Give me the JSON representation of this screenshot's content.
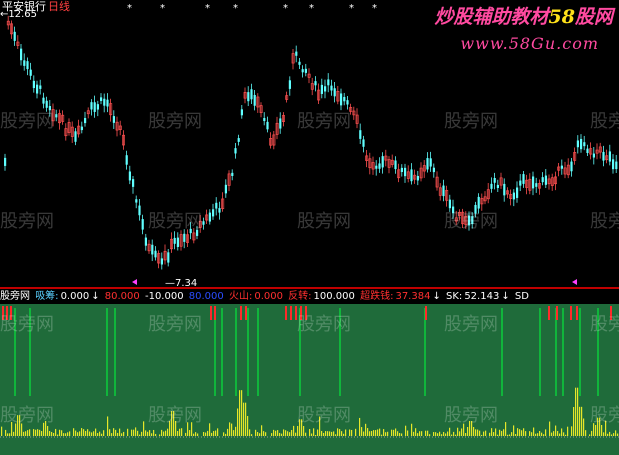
{
  "chart": {
    "stock_name": "平安银行",
    "period": "日线",
    "high_label": "12.65",
    "low_label": "7.34"
  },
  "branding": {
    "brand_part1": "炒股辅助教材",
    "brand_part2": "58",
    "brand_part3": "股网",
    "site_url": "www.58Gu.com",
    "watermark": "股旁网"
  },
  "indicator": {
    "name": "股旁网",
    "items": [
      {
        "label": "吸筹:",
        "value": "0.000"
      },
      {
        "label": "",
        "value": "80.000"
      },
      {
        "label": "",
        "value": "-10.000"
      },
      {
        "label": "",
        "value": "80.000"
      },
      {
        "label": "火山:",
        "value": "0.000"
      },
      {
        "label": "反转:",
        "value": "100.000"
      },
      {
        "label": "超跌钱:",
        "value": "37.384"
      },
      {
        "label": "SK:",
        "value": "52.143"
      },
      {
        "label": "SD",
        "value": ""
      }
    ]
  },
  "colors": {
    "up_candle": "#ff5050",
    "down_candle": "#60ffff",
    "indicator_bg": "#1f6b3a",
    "green_signal": "#00ff3c",
    "red_signal": "#ff2a2a",
    "volume_bar": "#e6e62a",
    "separator": "#c00000"
  },
  "stars": [
    "*",
    "*",
    "*",
    "*",
    "*",
    "*",
    "*",
    "*"
  ]
}
